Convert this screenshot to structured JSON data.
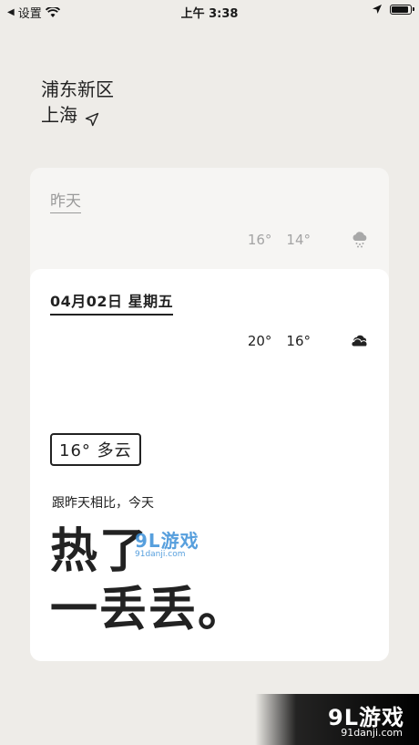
{
  "status_bar": {
    "back_label": "设置",
    "time": "上午 3:38",
    "battery_level": 0.9
  },
  "location": {
    "district": "浦东新区",
    "city": "上海"
  },
  "yesterday": {
    "label": "昨天",
    "high": "16°",
    "low": "14°",
    "icon": "rain-cloud-icon"
  },
  "today": {
    "date": "04月02日 星期五",
    "high": "20°",
    "low": "16°",
    "icon": "cloudy-icon",
    "condition": "16° 多云",
    "compare_text": "跟昨天相比，今天",
    "headline_line1": "热了",
    "headline_line2": "一丢丢。"
  },
  "watermarks": {
    "center_brand": "9L游戏",
    "center_site": "91danji.com",
    "corner_brand": "9L游戏",
    "corner_site": "91danji.com"
  }
}
